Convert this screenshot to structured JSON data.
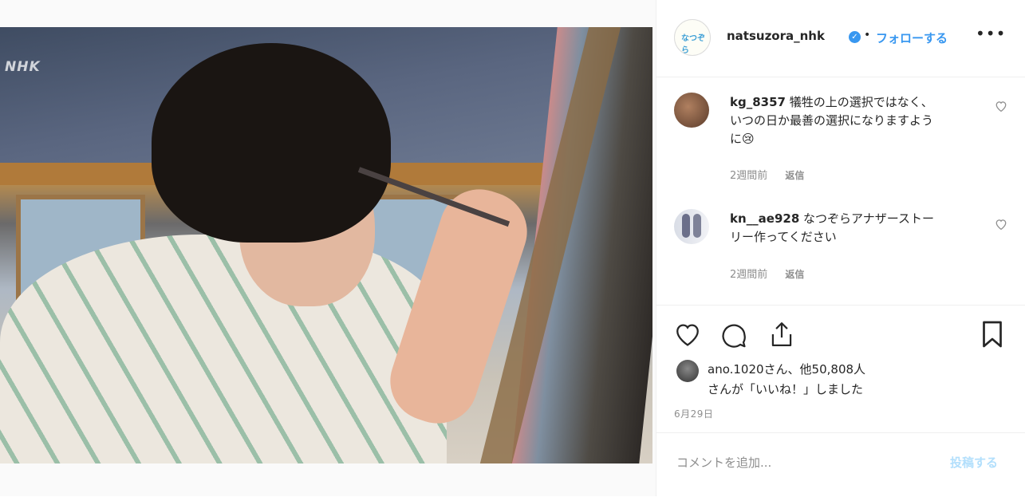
{
  "photo": {
    "watermark": "NHK"
  },
  "header": {
    "username": "natsuzora_nhk",
    "verified": "✓",
    "separator": "•",
    "follow_label": "フォローする",
    "more_label": "•••",
    "avatar_text": "なつぞら"
  },
  "comments": [
    {
      "username": "kg_8357",
      "text_line1": "犠牲の上の選択ではなく、",
      "text_line2": "いつの日か最善の選択になりますよう",
      "text_line3": "に😢",
      "time": "2週間前",
      "reply": "返信"
    },
    {
      "username": "kn__ae928",
      "text_line1": "なつぞらアナザーストー",
      "text_line2": "リー作ってください",
      "time": "2週間前",
      "reply": "返信"
    }
  ],
  "likes": {
    "line1": "ano.1020さん、他50,808人",
    "line2": "さんが「いいね！」しました"
  },
  "date": "6月29日",
  "comment_input": {
    "placeholder": "コメントを追加...",
    "post_label": "投稿する"
  },
  "colors": {
    "accent": "#3897f0",
    "text": "#262626",
    "muted": "#8e8e8e",
    "border": "#efefef"
  }
}
